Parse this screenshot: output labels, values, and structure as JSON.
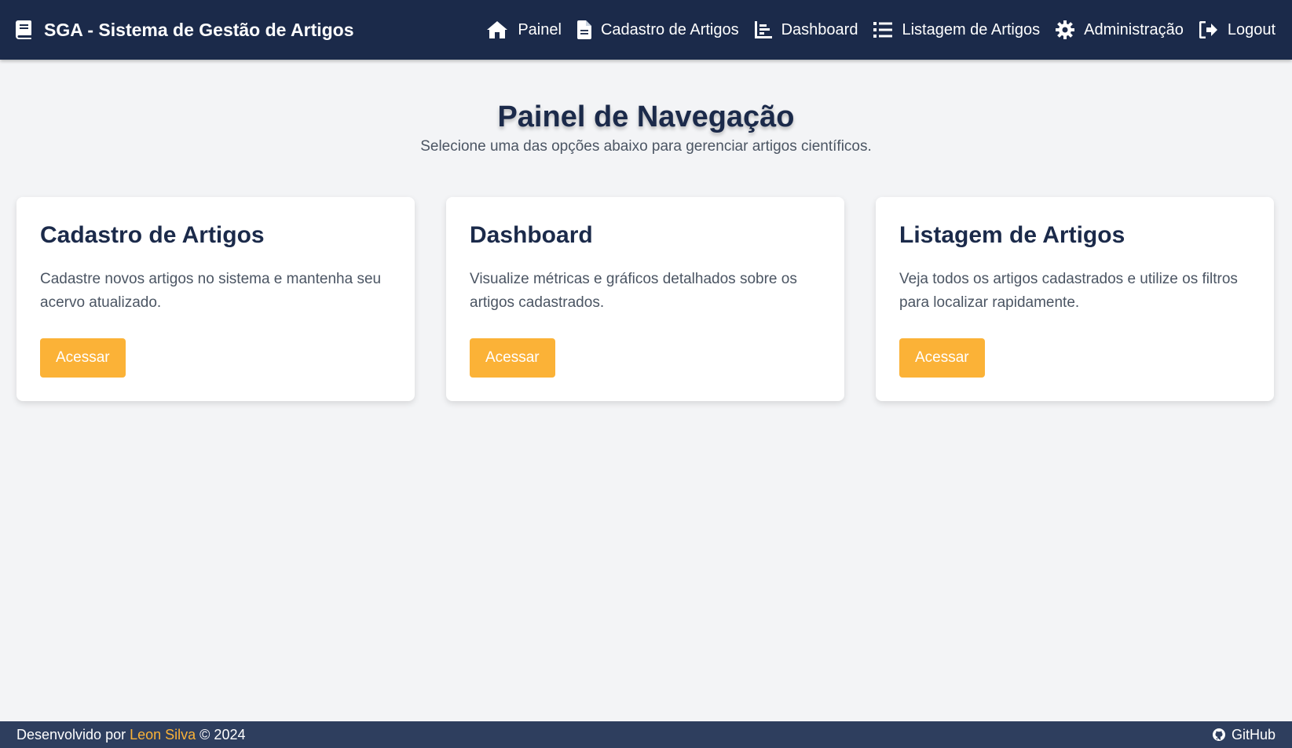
{
  "brand": {
    "title": "SGA - Sistema de Gestão de Artigos",
    "icon": "book-icon"
  },
  "nav": {
    "items": [
      {
        "label": "Painel",
        "icon": "home-icon"
      },
      {
        "label": "Cadastro de Artigos",
        "icon": "file-icon"
      },
      {
        "label": "Dashboard",
        "icon": "chart-icon"
      },
      {
        "label": "Listagem de Artigos",
        "icon": "list-icon"
      },
      {
        "label": "Administração",
        "icon": "gear-icon"
      },
      {
        "label": "Logout",
        "icon": "logout-icon"
      }
    ]
  },
  "main": {
    "title": "Painel de Navegação",
    "subtitle": "Selecione uma das opções abaixo para gerenciar artigos científicos."
  },
  "cards": [
    {
      "title": "Cadastro de Artigos",
      "description": "Cadastre novos artigos no sistema e mantenha seu acervo atualizado.",
      "button": "Acessar"
    },
    {
      "title": "Dashboard",
      "description": "Visualize métricas e gráficos detalhados sobre os artigos cadastrados.",
      "button": "Acessar"
    },
    {
      "title": "Listagem de Artigos",
      "description": "Veja todos os artigos cadastrados e utilize os filtros para localizar rapidamente.",
      "button": "Acessar"
    }
  ],
  "footer": {
    "prefix": "Desenvolvido por",
    "author": "Leon Silva",
    "suffix": "© 2024",
    "github": "GitHub"
  },
  "colors": {
    "navbar": "#1b2a4a",
    "footer": "#2e3e5e",
    "accent": "#fbb237",
    "background": "#f3f4f6"
  }
}
